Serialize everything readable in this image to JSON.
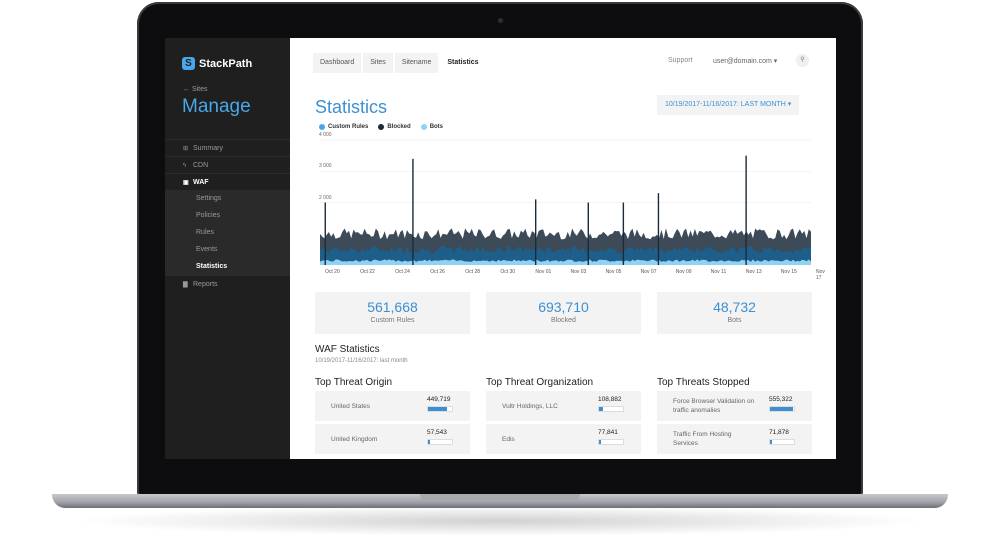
{
  "brand": {
    "name": "StackPath",
    "logo_glyph": "S"
  },
  "sidebar": {
    "back_label": "Sites",
    "heading": "Manage",
    "items": [
      {
        "icon": "grid-icon",
        "glyph": "⊞",
        "label": "Summary"
      },
      {
        "icon": "bolt-icon",
        "glyph": "ϟ",
        "label": "CDN"
      },
      {
        "icon": "shield-icon",
        "glyph": "▣",
        "label": "WAF"
      },
      {
        "icon": "chart-icon",
        "glyph": "▇",
        "label": "Reports"
      }
    ],
    "waf_sub": [
      "Settings",
      "Policies",
      "Rules",
      "Events",
      "Statistics"
    ]
  },
  "header": {
    "tabs": [
      "Dashboard",
      "Sites",
      "Sitename",
      "Statistics"
    ],
    "support": "Support",
    "user": "user@domain.com ▾",
    "search_glyph": "⚲"
  },
  "page": {
    "title": "Statistics",
    "date_range": "10/19/2017-11/16/2017: LAST MONTH ▾"
  },
  "colors": {
    "custom_rules": "#4aa6e8",
    "blocked": "#1c2a3a",
    "bots": "#8fd3f2",
    "accent": "#3d8fd1"
  },
  "chart_data": {
    "type": "area",
    "series": [
      {
        "name": "Custom Rules",
        "color": "#4aa6e8"
      },
      {
        "name": "Blocked",
        "color": "#1c2a3a"
      },
      {
        "name": "Bots",
        "color": "#8fd3f2"
      }
    ],
    "ytick_labels": [
      "4 000",
      "3 000",
      "2 000"
    ],
    "xtick_labels": [
      "Oct 20",
      "Oct 22",
      "Oct 24",
      "Oct 26",
      "Oct 28",
      "Oct 30",
      "Nov 01",
      "Nov 03",
      "Nov 05",
      "Nov 07",
      "Nov 09",
      "Nov 11",
      "Nov 13",
      "Nov 15",
      "Nov 17"
    ],
    "ylim": [
      0,
      4000
    ],
    "blocked_baseline": 1000,
    "custom_rules_baseline": 900,
    "bots_baseline": 100,
    "spikes": [
      {
        "date": "Oct 20",
        "value": 2000
      },
      {
        "date": "Oct 25",
        "value": 3400
      },
      {
        "date": "Nov 01",
        "value": 2100
      },
      {
        "date": "Nov 04",
        "value": 2000
      },
      {
        "date": "Nov 06",
        "value": 2000
      },
      {
        "date": "Nov 08",
        "value": 2300
      },
      {
        "date": "Nov 13",
        "value": 3500
      }
    ]
  },
  "stats": [
    {
      "value": "561,668",
      "label": "Custom Rules"
    },
    {
      "value": "693,710",
      "label": "Blocked"
    },
    {
      "value": "48,732",
      "label": "Bots"
    }
  ],
  "waf": {
    "title": "WAF Statistics",
    "subtitle": "10/19/2017-11/16/2017: last month",
    "columns": [
      {
        "title": "Top Threat Origin",
        "rows": [
          {
            "label": "United States",
            "value": "449,719",
            "fill": 0.8
          },
          {
            "label": "United Kingdom",
            "value": "57,543",
            "fill": 0.1
          }
        ]
      },
      {
        "title": "Top Threat Organization",
        "rows": [
          {
            "label": "Vultr Holdings, LLC",
            "value": "108,882",
            "fill": 0.15
          },
          {
            "label": "Edis",
            "value": "77,841",
            "fill": 0.1
          }
        ]
      },
      {
        "title": "Top Threats Stopped",
        "rows": [
          {
            "label": "Force Browser Validation on traffic anomalies",
            "value": "555,322",
            "fill": 0.95
          },
          {
            "label": "Traffic From Hosting Services",
            "value": "71,878",
            "fill": 0.1
          }
        ]
      }
    ]
  }
}
